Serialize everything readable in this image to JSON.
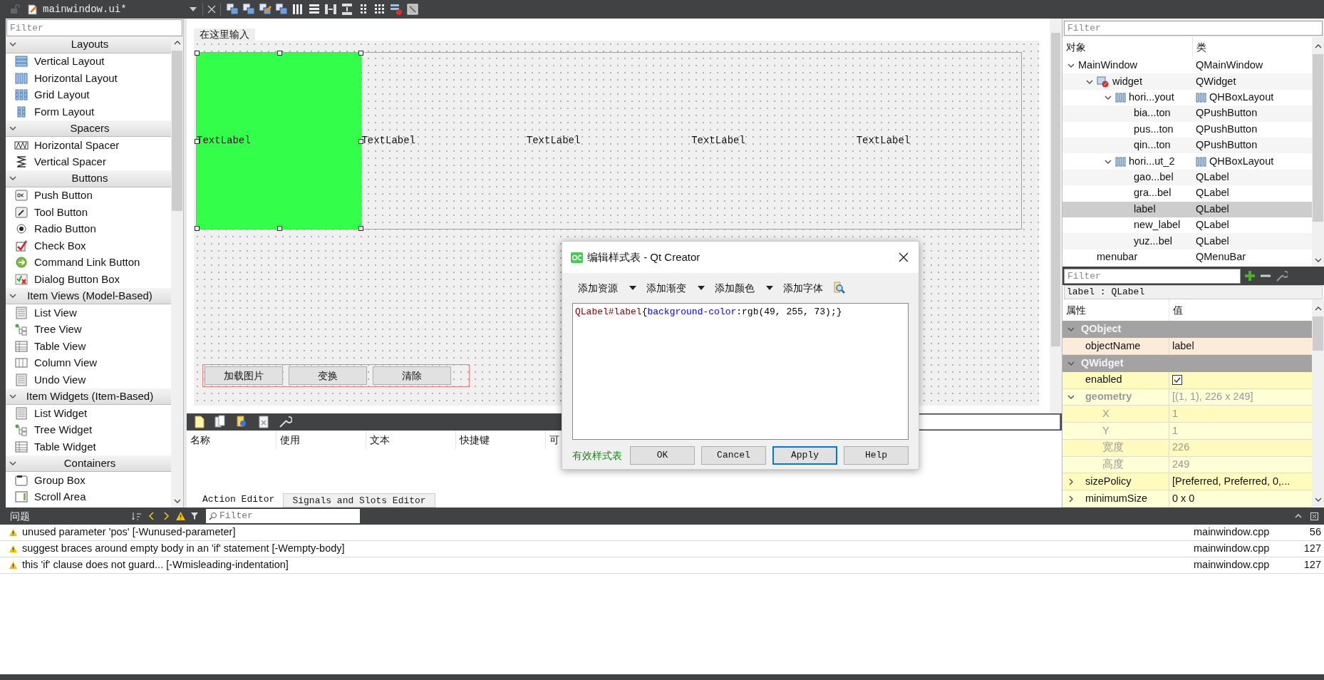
{
  "editor_bar": {
    "file": "mainwindow.ui*"
  },
  "widget_box": {
    "filter_placeholder": "Filter",
    "categories": [
      {
        "title": "Layouts",
        "expanded": true,
        "items": [
          "Vertical Layout",
          "Horizontal Layout",
          "Grid Layout",
          "Form Layout"
        ]
      },
      {
        "title": "Spacers",
        "expanded": true,
        "items": [
          "Horizontal Spacer",
          "Vertical Spacer"
        ]
      },
      {
        "title": "Buttons",
        "expanded": true,
        "items": [
          "Push Button",
          "Tool Button",
          "Radio Button",
          "Check Box",
          "Command Link Button",
          "Dialog Button Box"
        ]
      },
      {
        "title": "Item Views (Model-Based)",
        "expanded": true,
        "items": [
          "List View",
          "Tree View",
          "Table View",
          "Column View",
          "Undo View"
        ]
      },
      {
        "title": "Item Widgets (Item-Based)",
        "expanded": true,
        "items": [
          "List Widget",
          "Tree Widget",
          "Table Widget"
        ]
      },
      {
        "title": "Containers",
        "expanded": true,
        "items": [
          "Group Box",
          "Scroll Area"
        ]
      }
    ]
  },
  "form": {
    "menu_placeholder": "在这里输入",
    "labels": [
      {
        "text": "TextLabel",
        "selected": true,
        "color": "#33ff4a"
      },
      {
        "text": "TextLabel",
        "selected": false
      },
      {
        "text": "TextLabel",
        "selected": false
      },
      {
        "text": "TextLabel",
        "selected": false
      },
      {
        "text": "TextLabel",
        "selected": false
      }
    ],
    "buttons": [
      "加载图片",
      "变换",
      "清除"
    ]
  },
  "action_editor": {
    "columns": [
      "名称",
      "使用",
      "文本",
      "快捷键",
      "可"
    ],
    "tabs": [
      {
        "label": "Action Editor",
        "selected": true
      },
      {
        "label": "Signals and Slots Editor",
        "selected": false
      }
    ]
  },
  "object_inspector": {
    "filter_placeholder": "Filter",
    "columns": [
      "对象",
      "类"
    ],
    "tree": [
      {
        "name": "MainWindow",
        "class": "QMainWindow",
        "selected": false,
        "expanded": true,
        "children": [
          {
            "name": "widget",
            "class": "QWidget",
            "kind": "widget",
            "selected": false,
            "expanded": true,
            "children": [
              {
                "name": "hori...yout",
                "class": "QHBoxLayout",
                "kind": "layout",
                "selected": false,
                "expanded": true,
                "children": [
                  {
                    "name": "bia...ton",
                    "class": "QPushButton",
                    "selected": false
                  },
                  {
                    "name": "pus...ton",
                    "class": "QPushButton",
                    "selected": false
                  },
                  {
                    "name": "qin...ton",
                    "class": "QPushButton",
                    "selected": false
                  }
                ]
              },
              {
                "name": "hori...ut_2",
                "class": "QHBoxLayout",
                "kind": "layout",
                "selected": false,
                "expanded": true,
                "children": [
                  {
                    "name": "gao...bel",
                    "class": "QLabel",
                    "selected": false
                  },
                  {
                    "name": "gra...bel",
                    "class": "QLabel",
                    "selected": false
                  },
                  {
                    "name": "label",
                    "class": "QLabel",
                    "selected": true
                  },
                  {
                    "name": "new_label",
                    "class": "QLabel",
                    "selected": false
                  },
                  {
                    "name": "yuz...bel",
                    "class": "QLabel",
                    "selected": false
                  }
                ]
              }
            ]
          },
          {
            "name": "menubar",
            "class": "QMenuBar",
            "selected": false
          }
        ]
      }
    ]
  },
  "property_editor": {
    "filter_placeholder": "Filter",
    "object": "label : QLabel",
    "columns": [
      "属性",
      "值"
    ],
    "groups": [
      {
        "name": "QObject",
        "expanded": true,
        "properties": [
          {
            "name": "objectName",
            "kind": "text",
            "value": "label",
            "disabled": false
          }
        ]
      },
      {
        "name": "QWidget",
        "expanded": true,
        "properties": [
          {
            "name": "enabled",
            "kind": "checkbox",
            "checked": true,
            "disabled": false
          },
          {
            "name": "geometry",
            "kind": "text",
            "value": "[(1, 1), 226 x 249]",
            "disabled": true,
            "expanded": true,
            "children": [
              {
                "name": "X",
                "kind": "text",
                "value": "1",
                "disabled": true
              },
              {
                "name": "Y",
                "kind": "text",
                "value": "1",
                "disabled": true
              },
              {
                "name": "宽度",
                "kind": "text",
                "value": "226",
                "disabled": true
              },
              {
                "name": "高度",
                "kind": "text",
                "value": "249",
                "disabled": true
              }
            ]
          },
          {
            "name": "sizePolicy",
            "kind": "text",
            "value": "[Preferred, Preferred, 0,...",
            "disabled": false,
            "expanded": false
          },
          {
            "name": "minimumSize",
            "kind": "text",
            "value": "0 x 0",
            "disabled": false,
            "expanded": false
          }
        ]
      }
    ]
  },
  "dialog": {
    "title": "编辑样式表 - Qt Creator",
    "tools": [
      {
        "label": "添加资源",
        "dropdown": true
      },
      {
        "label": "添加渐变",
        "dropdown": true
      },
      {
        "label": "添加颜色",
        "dropdown": true
      },
      {
        "label": "添加字体",
        "dropdown": false
      }
    ],
    "code": [
      {
        "text": "QLabel#label",
        "color": "#800000"
      },
      {
        "text": "{",
        "color": "#000000"
      },
      {
        "text": "background-color",
        "color": "#0000ff"
      },
      {
        "text": ":rgb(49, 255, 73);}",
        "color": "#000000"
      }
    ],
    "status": {
      "text": "有效样式表",
      "valid": true
    },
    "buttons": [
      {
        "label": "OK",
        "selected": false
      },
      {
        "label": "Cancel",
        "selected": false
      },
      {
        "label": "Apply",
        "selected": true
      },
      {
        "label": "Help",
        "selected": false
      }
    ]
  },
  "issues": {
    "title": "问题",
    "filter_placeholder": "Filter",
    "rows": [
      {
        "text": "unused parameter 'pos' [-Wunused-parameter]",
        "file": "mainwindow.cpp",
        "line": "56"
      },
      {
        "text": "suggest braces around empty body in an 'if' statement [-Wempty-body]",
        "file": "mainwindow.cpp",
        "line": "127"
      },
      {
        "text": "this 'if' clause does not guard... [-Wmisleading-indentation]",
        "file": "mainwindow.cpp",
        "line": "127"
      }
    ]
  }
}
